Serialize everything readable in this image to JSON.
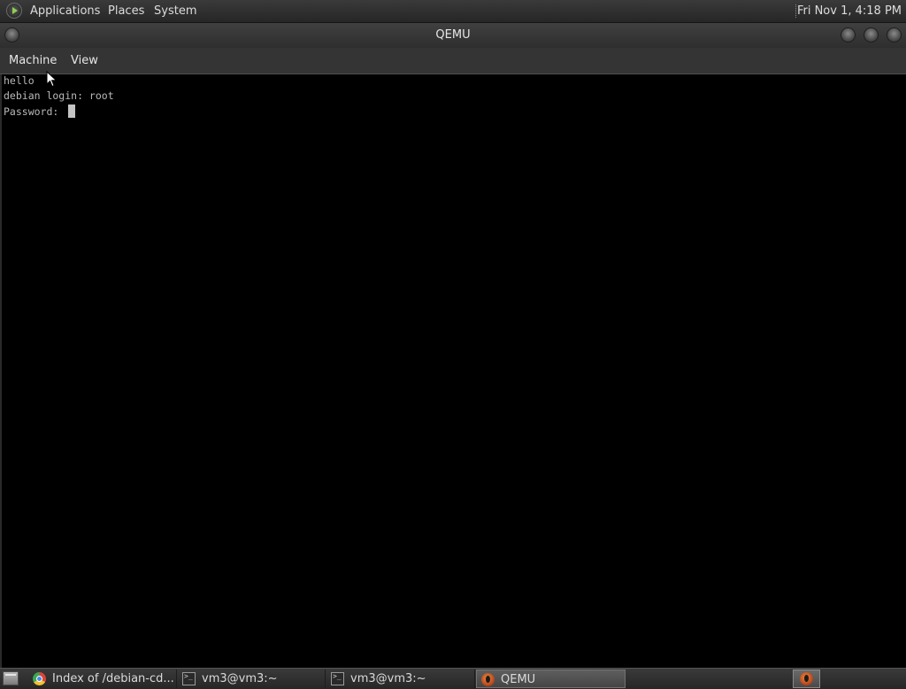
{
  "top_panel": {
    "menus": [
      "Applications",
      "Places",
      "System"
    ],
    "clock": "Fri Nov 1,  4:18 PM"
  },
  "window": {
    "title": "QEMU",
    "menu": [
      "Machine",
      "View"
    ]
  },
  "console": {
    "lines": [
      "hello",
      "debian login: root",
      "Password: "
    ]
  },
  "taskbar": {
    "tasks": [
      {
        "label": "Index of /debian-cd...",
        "icon": "chrome-icon"
      },
      {
        "label": "vm3@vm3:~",
        "icon": "terminal-icon"
      },
      {
        "label": "vm3@vm3:~",
        "icon": "terminal-icon"
      },
      {
        "label": "QEMU",
        "icon": "qemu-icon",
        "active": true
      }
    ]
  }
}
